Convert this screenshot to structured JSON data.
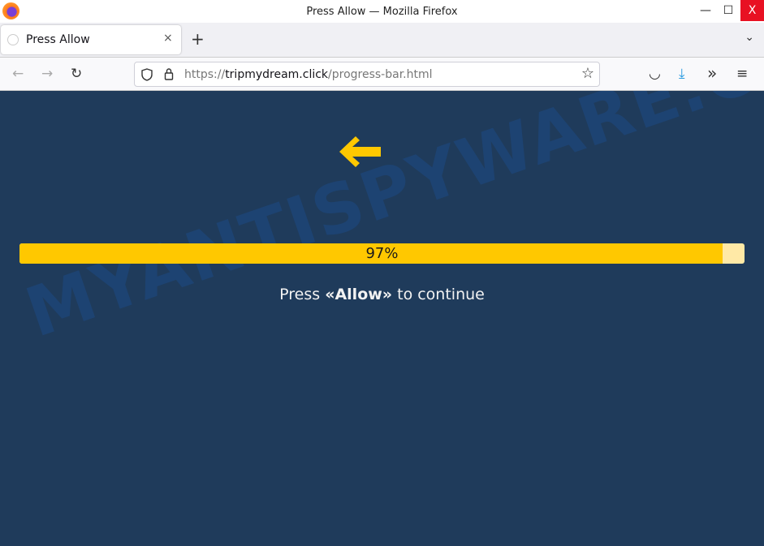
{
  "window": {
    "title": "Press Allow — Mozilla Firefox",
    "minimize": "—",
    "maximize": "☐",
    "close": "X"
  },
  "tabs": [
    {
      "label": "Press Allow",
      "close": "×"
    }
  ],
  "new_tab": "+",
  "tab_list": "⌄",
  "nav": {
    "back": "←",
    "forward": "→",
    "reload": "↻",
    "url_scheme": "https://",
    "url_domain": "tripmydream.click",
    "url_path": "/progress-bar.html",
    "bookmark": "☆",
    "pocket": "◡",
    "downloads": "⤓",
    "overflow": "»",
    "menu": "≡"
  },
  "page": {
    "progress_percent": 97,
    "progress_label": "97%",
    "message_prefix": "Press ",
    "message_bold": "«Allow»",
    "message_suffix": " to continue",
    "accent": "#ffc800",
    "background": "#1f3b5b"
  },
  "watermark": "MYANTISPYWARE.COM"
}
